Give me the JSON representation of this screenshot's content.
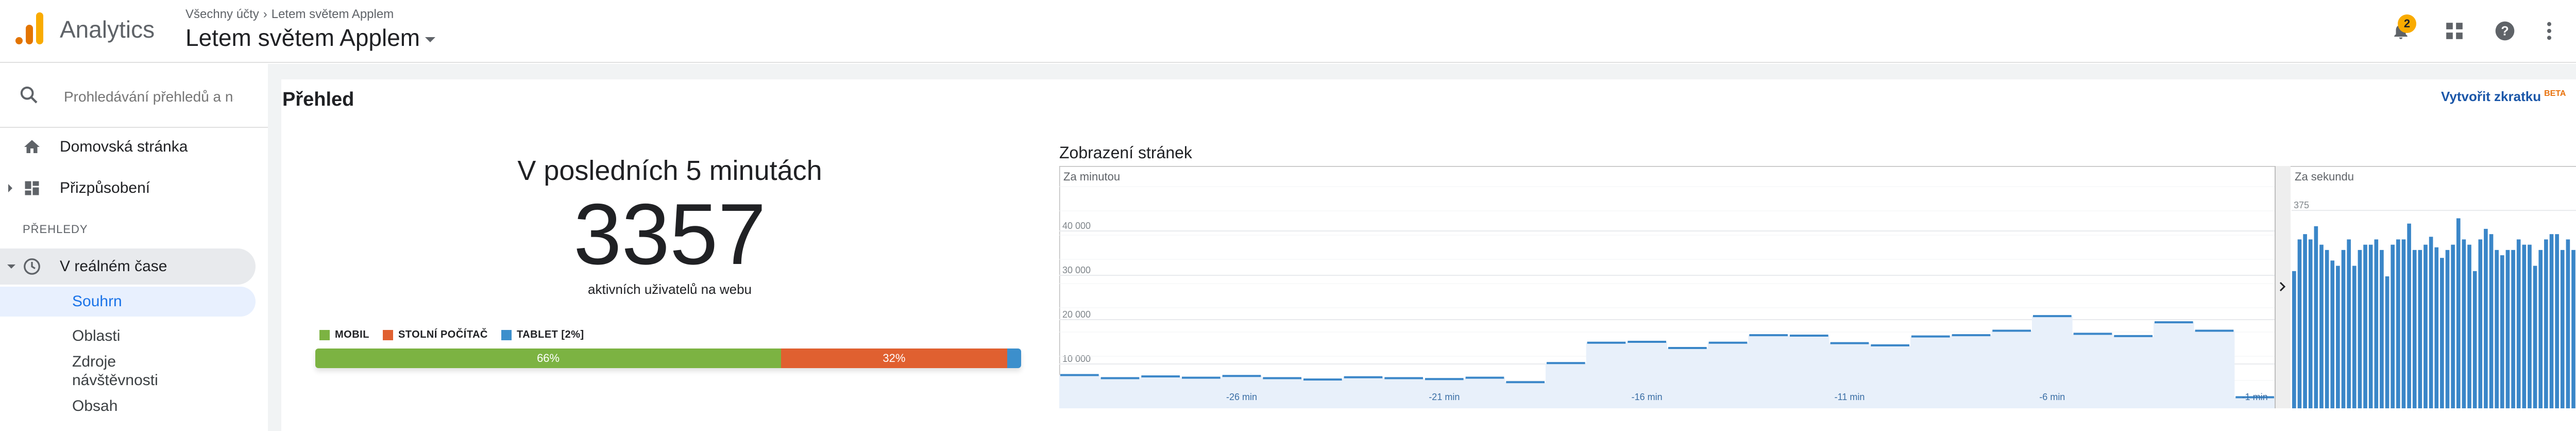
{
  "header": {
    "app_name": "Analytics",
    "breadcrumb": [
      "Všechny účty",
      "Letem světem Applem"
    ],
    "account_name": "Letem světem Applem",
    "notifications_count": "2",
    "avatar_text": "ž2"
  },
  "sidebar": {
    "search_placeholder": "Prohledávání přehledů a náp",
    "items": [
      {
        "label": "Domovská stránka",
        "icon": "home-icon"
      },
      {
        "label": "Přizpůsobení",
        "icon": "dashboard-icon"
      }
    ],
    "section_label": "PŘEHLEDY",
    "realtime": {
      "label": "V reálném čase",
      "icon": "clock-icon"
    },
    "subitems": [
      "Souhrn",
      "Oblasti",
      "Zdroje návštěvnosti",
      "Obsah"
    ]
  },
  "main": {
    "title": "Přehled",
    "shortcut_label": "Vytvořit zkratku",
    "shortcut_badge": "BETA",
    "realtime": {
      "heading": "V posledních 5 minutách",
      "active_users": "3357",
      "caption": "aktivních uživatelů na webu"
    },
    "devices": {
      "legend": [
        {
          "label": "MOBIL",
          "color": "#7cb342"
        },
        {
          "label": "STOLNÍ POČÍTAČ",
          "color": "#e06030"
        },
        {
          "label": "TABLET [2%]",
          "color": "#3c8fcc"
        }
      ],
      "segments": [
        {
          "label": "66%",
          "value": 66,
          "color": "#7cb342"
        },
        {
          "label": "32%",
          "value": 32,
          "color": "#e06030"
        },
        {
          "label": "",
          "value": 2,
          "color": "#3c8fcc"
        }
      ]
    },
    "pageviews": {
      "title": "Zobrazení stránek",
      "per_minute_label": "Za minutou",
      "per_second_label": "Za sekundu"
    }
  },
  "chart_data": [
    {
      "type": "area",
      "title": "Zobrazení stránek",
      "series_label": "Za minutou",
      "y_ticks": [
        "40 000",
        "30 000",
        "20 000",
        "10 000"
      ],
      "ylim": [
        0,
        50000
      ],
      "x_tick_labels": [
        "-26 min",
        "-21 min",
        "-16 min",
        "-11 min",
        "-6 min",
        "-1 min"
      ],
      "x": [
        -30,
        -29,
        -28,
        -27,
        -26,
        -25,
        -24,
        -23,
        -22,
        -21,
        -20,
        -19,
        -18,
        -17,
        -16,
        -15,
        -14,
        -13,
        -12,
        -11,
        -10,
        -9,
        -8,
        -7,
        -6,
        -5,
        -4,
        -3,
        -2,
        -1
      ],
      "values": [
        7500,
        6800,
        7200,
        6900,
        7300,
        6800,
        6500,
        7000,
        6800,
        6600,
        6900,
        5900,
        10200,
        14800,
        15000,
        13600,
        14800,
        16500,
        16400,
        14700,
        14200,
        16200,
        16500,
        17500,
        20800,
        16800,
        16300,
        19400,
        17500,
        2500
      ],
      "grid": true
    },
    {
      "type": "bar",
      "title": "",
      "series_label": "Za sekundu",
      "y_ticks": [
        "375"
      ],
      "ylim": [
        0,
        420
      ],
      "values": [
        260,
        320,
        330,
        320,
        345,
        310,
        300,
        280,
        270,
        300,
        320,
        270,
        300,
        310,
        310,
        320,
        300,
        250,
        310,
        320,
        320,
        350,
        300,
        300,
        310,
        325,
        305,
        285,
        300,
        310,
        360,
        320,
        310,
        260,
        320,
        340,
        330,
        300,
        290,
        300,
        300,
        320,
        310,
        310,
        270,
        300,
        320,
        330,
        330,
        300,
        320,
        300,
        320,
        310,
        340,
        330,
        310
      ],
      "grid": true
    }
  ]
}
